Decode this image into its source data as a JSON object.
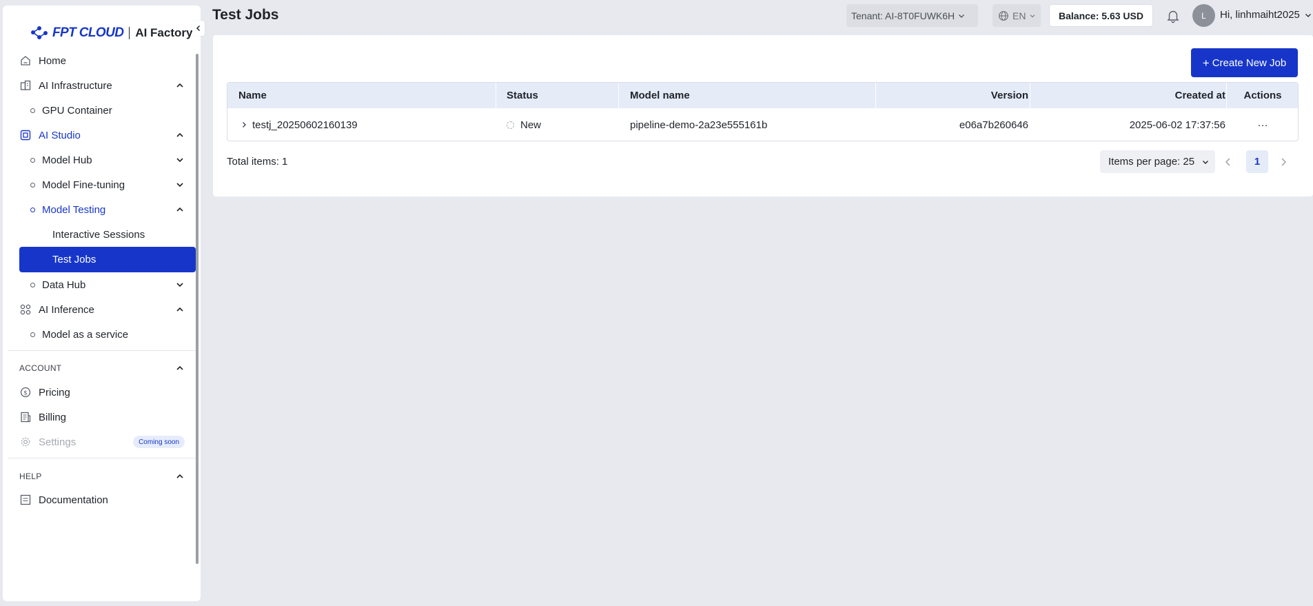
{
  "brand": {
    "logo_text": "FPT CLOUD",
    "product": "AI Factory"
  },
  "header": {
    "page_title": "Test Jobs",
    "tenant": "Tenant: AI-8T0FUWK6H",
    "language": "EN",
    "balance": "Balance: 5.63 USD",
    "avatar_initial": "L",
    "greeting": "Hi, linhmaiht2025"
  },
  "sidebar": {
    "home": "Home",
    "ai_infrastructure": "AI Infrastructure",
    "gpu_container": "GPU Container",
    "ai_studio": "AI Studio",
    "model_hub": "Model Hub",
    "model_fine_tuning": "Model Fine-tuning",
    "model_testing": "Model Testing",
    "interactive_sessions": "Interactive Sessions",
    "test_jobs": "Test Jobs",
    "data_hub": "Data Hub",
    "ai_inference": "AI Inference",
    "model_as_a_service": "Model as a service",
    "account_section": "ACCOUNT",
    "pricing": "Pricing",
    "billing": "Billing",
    "settings": "Settings",
    "settings_badge": "Coming soon",
    "help_section": "HELP",
    "documentation": "Documentation"
  },
  "toolbar": {
    "create_label": "Create New Job"
  },
  "table": {
    "columns": [
      "Name",
      "Status",
      "Model name",
      "Version",
      "Created at",
      "Actions"
    ],
    "rows": [
      {
        "name": "testj_20250602160139",
        "status": "New",
        "model_name": "pipeline-demo-2a23e555161b",
        "version": "e06a7b260646",
        "created_at": "2025-06-02 17:37:56",
        "actions": "···"
      }
    ]
  },
  "pagination": {
    "total": "Total items: 1",
    "per_page": "Items per page: 25",
    "current_page": "1"
  },
  "colors": {
    "accent": "#1736c9",
    "background": "#e8e9ee",
    "header_row": "#e6ebf8"
  }
}
